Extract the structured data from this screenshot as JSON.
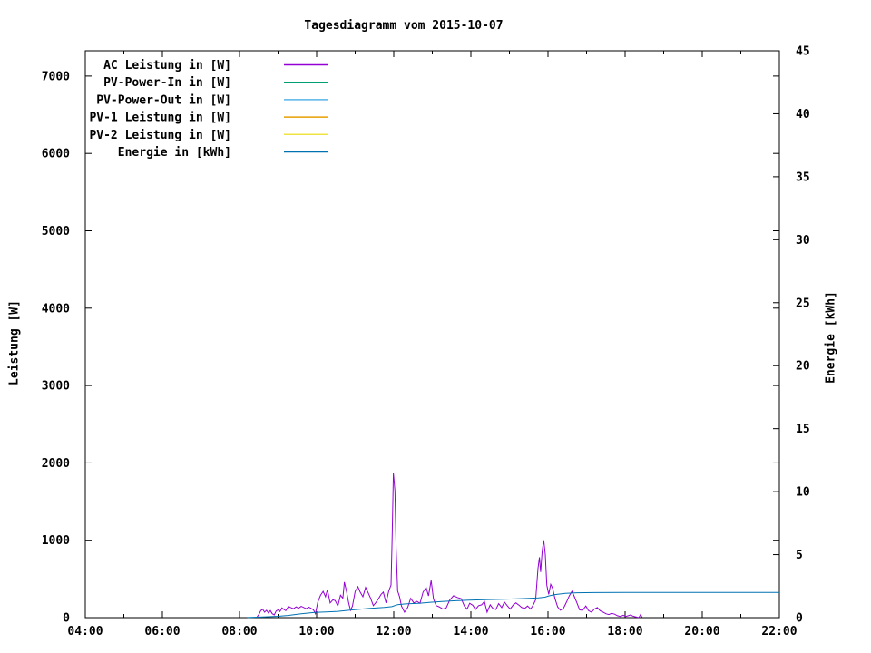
{
  "title": "Tagesdiagramm vom 2015-10-07",
  "axes": {
    "y_label": "Leistung [W]",
    "y2_label": "Energie [kWh]",
    "x_range": [
      4,
      22
    ],
    "y_range": [
      0,
      7327
    ],
    "y2_range": [
      0,
      45
    ],
    "x_major_ticks": [
      {
        "hour": 4,
        "label": "04:00"
      },
      {
        "hour": 6,
        "label": "06:00"
      },
      {
        "hour": 8,
        "label": "08:00"
      },
      {
        "hour": 10,
        "label": "10:00"
      },
      {
        "hour": 12,
        "label": "12:00"
      },
      {
        "hour": 14,
        "label": "14:00"
      },
      {
        "hour": 16,
        "label": "16:00"
      },
      {
        "hour": 18,
        "label": "18:00"
      },
      {
        "hour": 20,
        "label": "20:00"
      },
      {
        "hour": 22,
        "label": "22:00"
      }
    ],
    "x_minor_hours": [
      5,
      7,
      9,
      11,
      13,
      15,
      17,
      19,
      21
    ],
    "y_ticks": [
      0,
      1000,
      2000,
      3000,
      4000,
      5000,
      6000,
      7000
    ],
    "y2_ticks": [
      0,
      5,
      10,
      15,
      20,
      25,
      30,
      35,
      40,
      45
    ]
  },
  "legend": [
    {
      "label": "AC Leistung in [W]",
      "color": "#9400d3"
    },
    {
      "label": "PV-Power-In in [W]",
      "color": "#009e73"
    },
    {
      "label": "PV-Power-Out in [W]",
      "color": "#56b4e9"
    },
    {
      "label": "PV-1 Leistung in [W]",
      "color": "#e69f00"
    },
    {
      "label": "PV-2 Leistung in [W]",
      "color": "#f0e442"
    },
    {
      "label": "Energie in [kWh]",
      "color": "#0072b2"
    }
  ],
  "chart_data": {
    "type": "line",
    "title": "Tagesdiagramm vom 2015-10-07",
    "xlabel": "",
    "ylabel": "Leistung [W]",
    "y2label": "Energie [kWh]",
    "x_unit": "hour_of_day",
    "xlim": [
      4,
      22
    ],
    "ylim": [
      0,
      7327
    ],
    "y2lim": [
      0,
      45
    ],
    "grid": false,
    "legend_position": "top-left-inside",
    "series": [
      {
        "id": "ac",
        "name": "AC Leistung in [W]",
        "color": "#9400d3",
        "axis": "y",
        "points": [
          [
            8.45,
            5
          ],
          [
            8.5,
            40
          ],
          [
            8.55,
            90
          ],
          [
            8.6,
            110
          ],
          [
            8.65,
            70
          ],
          [
            8.7,
            95
          ],
          [
            8.75,
            60
          ],
          [
            8.8,
            90
          ],
          [
            8.85,
            50
          ],
          [
            8.9,
            35
          ],
          [
            8.95,
            85
          ],
          [
            9.0,
            100
          ],
          [
            9.05,
            80
          ],
          [
            9.1,
            125
          ],
          [
            9.15,
            105
          ],
          [
            9.2,
            90
          ],
          [
            9.27,
            145
          ],
          [
            9.33,
            130
          ],
          [
            9.4,
            115
          ],
          [
            9.47,
            140
          ],
          [
            9.53,
            120
          ],
          [
            9.6,
            145
          ],
          [
            9.67,
            130
          ],
          [
            9.73,
            115
          ],
          [
            9.8,
            135
          ],
          [
            9.87,
            115
          ],
          [
            9.92,
            100
          ],
          [
            9.97,
            50
          ],
          [
            10.03,
            200
          ],
          [
            10.1,
            290
          ],
          [
            10.17,
            340
          ],
          [
            10.23,
            270
          ],
          [
            10.28,
            360
          ],
          [
            10.35,
            190
          ],
          [
            10.42,
            230
          ],
          [
            10.48,
            220
          ],
          [
            10.55,
            150
          ],
          [
            10.62,
            290
          ],
          [
            10.68,
            250
          ],
          [
            10.72,
            460
          ],
          [
            10.78,
            330
          ],
          [
            10.83,
            190
          ],
          [
            10.88,
            95
          ],
          [
            10.93,
            150
          ],
          [
            11.0,
            340
          ],
          [
            11.07,
            400
          ],
          [
            11.13,
            330
          ],
          [
            11.2,
            270
          ],
          [
            11.27,
            390
          ],
          [
            11.33,
            330
          ],
          [
            11.4,
            250
          ],
          [
            11.47,
            155
          ],
          [
            11.53,
            190
          ],
          [
            11.6,
            240
          ],
          [
            11.67,
            300
          ],
          [
            11.73,
            330
          ],
          [
            11.8,
            190
          ],
          [
            11.87,
            345
          ],
          [
            11.93,
            420
          ],
          [
            11.96,
            1070
          ],
          [
            11.99,
            1870
          ],
          [
            12.03,
            1640
          ],
          [
            12.06,
            900
          ],
          [
            12.1,
            345
          ],
          [
            12.15,
            270
          ],
          [
            12.2,
            150
          ],
          [
            12.28,
            70
          ],
          [
            12.36,
            130
          ],
          [
            12.44,
            250
          ],
          [
            12.52,
            190
          ],
          [
            12.6,
            210
          ],
          [
            12.68,
            185
          ],
          [
            12.76,
            330
          ],
          [
            12.84,
            390
          ],
          [
            12.9,
            280
          ],
          [
            12.97,
            480
          ],
          [
            13.03,
            240
          ],
          [
            13.1,
            155
          ],
          [
            13.18,
            140
          ],
          [
            13.27,
            110
          ],
          [
            13.36,
            125
          ],
          [
            13.45,
            225
          ],
          [
            13.55,
            283
          ],
          [
            13.65,
            260
          ],
          [
            13.75,
            245
          ],
          [
            13.83,
            150
          ],
          [
            13.9,
            110
          ],
          [
            13.97,
            185
          ],
          [
            14.05,
            160
          ],
          [
            14.12,
            105
          ],
          [
            14.2,
            155
          ],
          [
            14.28,
            165
          ],
          [
            14.35,
            210
          ],
          [
            14.42,
            70
          ],
          [
            14.5,
            165
          ],
          [
            14.57,
            120
          ],
          [
            14.65,
            105
          ],
          [
            14.72,
            180
          ],
          [
            14.8,
            130
          ],
          [
            14.87,
            200
          ],
          [
            14.95,
            150
          ],
          [
            15.02,
            110
          ],
          [
            15.1,
            165
          ],
          [
            15.17,
            190
          ],
          [
            15.25,
            160
          ],
          [
            15.32,
            130
          ],
          [
            15.4,
            120
          ],
          [
            15.47,
            150
          ],
          [
            15.55,
            110
          ],
          [
            15.62,
            165
          ],
          [
            15.68,
            230
          ],
          [
            15.74,
            640
          ],
          [
            15.78,
            780
          ],
          [
            15.81,
            590
          ],
          [
            15.85,
            860
          ],
          [
            15.89,
            1000
          ],
          [
            15.93,
            820
          ],
          [
            15.97,
            420
          ],
          [
            16.02,
            300
          ],
          [
            16.07,
            430
          ],
          [
            16.12,
            380
          ],
          [
            16.18,
            250
          ],
          [
            16.25,
            140
          ],
          [
            16.32,
            95
          ],
          [
            16.4,
            120
          ],
          [
            16.48,
            200
          ],
          [
            16.55,
            280
          ],
          [
            16.62,
            340
          ],
          [
            16.68,
            275
          ],
          [
            16.75,
            190
          ],
          [
            16.82,
            100
          ],
          [
            16.9,
            95
          ],
          [
            16.98,
            150
          ],
          [
            17.05,
            90
          ],
          [
            17.13,
            70
          ],
          [
            17.2,
            110
          ],
          [
            17.28,
            130
          ],
          [
            17.35,
            90
          ],
          [
            17.43,
            70
          ],
          [
            17.5,
            50
          ],
          [
            17.58,
            40
          ],
          [
            17.65,
            55
          ],
          [
            17.73,
            45
          ],
          [
            17.8,
            25
          ],
          [
            17.88,
            15
          ],
          [
            17.95,
            30
          ],
          [
            18.02,
            15
          ],
          [
            18.08,
            25
          ],
          [
            18.14,
            35
          ],
          [
            18.2,
            20
          ],
          [
            18.26,
            12
          ],
          [
            18.32,
            5
          ],
          [
            18.36,
            3
          ],
          [
            18.4,
            40
          ],
          [
            18.44,
            5
          ]
        ]
      },
      {
        "id": "pv_in",
        "name": "PV-Power-In in [W]",
        "color": "#009e73",
        "axis": "y",
        "points": []
      },
      {
        "id": "pv_out",
        "name": "PV-Power-Out in [W]",
        "color": "#56b4e9",
        "axis": "y",
        "points": []
      },
      {
        "id": "pv1",
        "name": "PV-1 Leistung in [W]",
        "color": "#e69f00",
        "axis": "y",
        "points": []
      },
      {
        "id": "pv2",
        "name": "PV-2 Leistung in [W]",
        "color": "#f0e442",
        "axis": "y",
        "points": []
      },
      {
        "id": "energie",
        "name": "Energie in [kWh]",
        "color": "#0072b2",
        "axis": "y2",
        "points": [
          [
            8.2,
            0.01
          ],
          [
            8.6,
            0.05
          ],
          [
            9.0,
            0.11
          ],
          [
            9.25,
            0.17
          ],
          [
            9.6,
            0.3
          ],
          [
            9.95,
            0.41
          ],
          [
            10.25,
            0.45
          ],
          [
            10.55,
            0.5
          ],
          [
            10.95,
            0.62
          ],
          [
            11.35,
            0.73
          ],
          [
            11.75,
            0.81
          ],
          [
            11.95,
            0.87
          ],
          [
            12.1,
            1.03
          ],
          [
            12.3,
            1.09
          ],
          [
            12.65,
            1.14
          ],
          [
            12.95,
            1.22
          ],
          [
            13.25,
            1.28
          ],
          [
            13.6,
            1.34
          ],
          [
            13.95,
            1.38
          ],
          [
            14.45,
            1.43
          ],
          [
            14.95,
            1.47
          ],
          [
            15.45,
            1.52
          ],
          [
            15.75,
            1.57
          ],
          [
            15.92,
            1.62
          ],
          [
            16.02,
            1.72
          ],
          [
            16.18,
            1.83
          ],
          [
            16.45,
            1.93
          ],
          [
            16.75,
            1.97
          ],
          [
            17.2,
            1.99
          ],
          [
            18.0,
            2.0
          ],
          [
            19.0,
            2.0
          ],
          [
            20.0,
            2.0
          ],
          [
            21.0,
            2.0
          ],
          [
            22.0,
            2.0
          ]
        ]
      }
    ]
  }
}
